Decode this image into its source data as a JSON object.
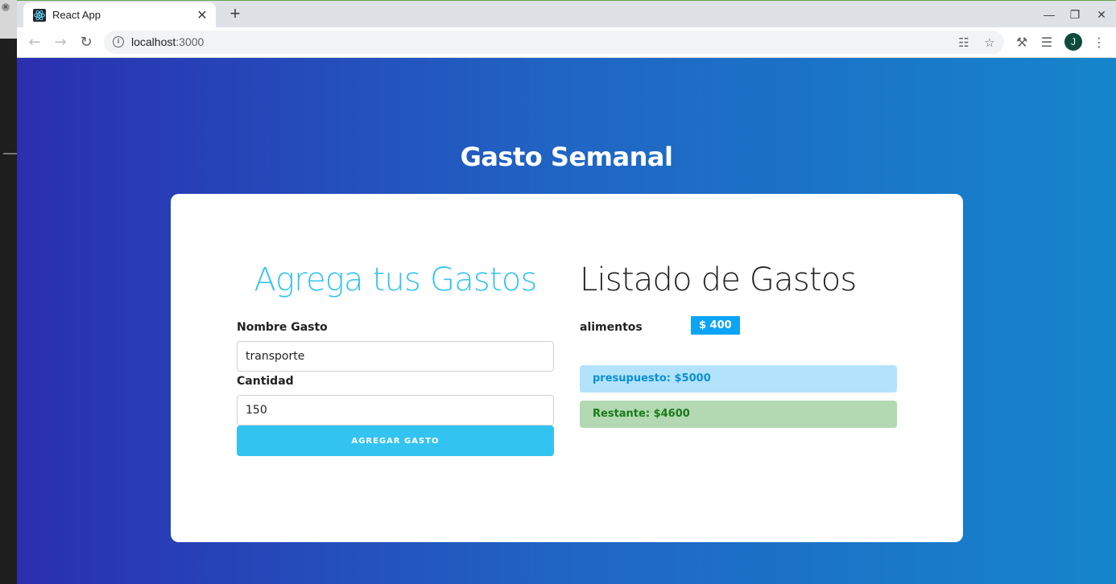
{
  "browser": {
    "tab_title": "React App",
    "tab_close": "✕",
    "new_tab": "+",
    "url_host": "localhost",
    "url_port": ":3000",
    "avatar_initial": "J"
  },
  "page": {
    "title": "Gasto Semanal"
  },
  "form": {
    "heading": "Agrega tus Gastos",
    "name_label": "Nombre Gasto",
    "name_value": "transporte",
    "amount_label": "Cantidad",
    "amount_value": "150",
    "submit_label": "AGREGAR GASTO"
  },
  "list": {
    "heading": "Listado de Gastos",
    "expenses": [
      {
        "name": "alimentos",
        "amount": "$ 400"
      }
    ],
    "budget": "presupuesto: $5000",
    "remaining": "Restante: $4600"
  },
  "colors": {
    "accent": "#33c3f0",
    "amount_badge": "#0ea4f5",
    "budget_bg": "#b3e3fc",
    "remaining_bg": "#b2d9b2"
  }
}
